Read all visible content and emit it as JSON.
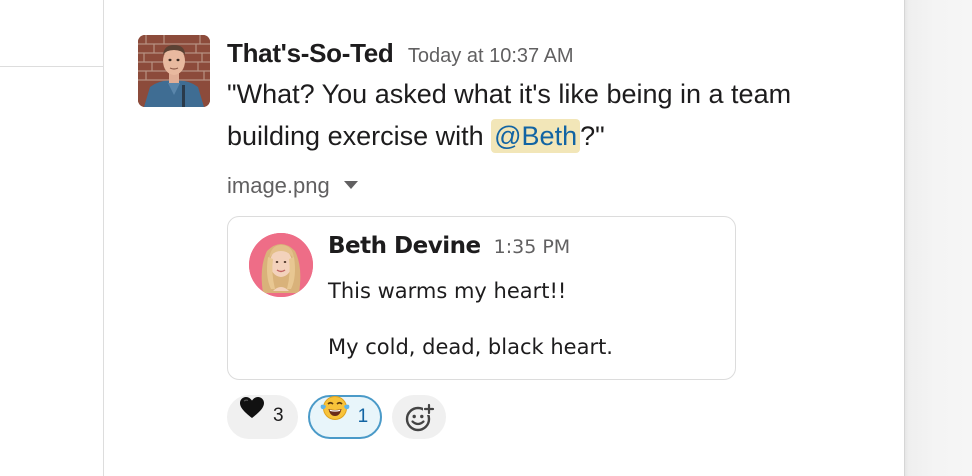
{
  "message": {
    "sender": "That's-So-Ted",
    "timestamp": "Today at 10:37 AM",
    "text_before_mention": "\"What? You asked what it's like being in a team building exercise with ",
    "mention": "@Beth",
    "text_after_mention": "?\"",
    "attachment": {
      "filename": "image.png",
      "caret_icon": "chevron-down-icon",
      "embedded": {
        "sender": "Beth Devine",
        "time": "1:35 PM",
        "line1": "This warms my heart!!",
        "line2": "My cold, dead, black heart."
      }
    },
    "reactions": [
      {
        "emoji": "black-heart",
        "count": "3",
        "active": false
      },
      {
        "emoji": "face-with-tears-of-joy",
        "count": "1",
        "active": true
      }
    ],
    "add_reaction_icon": "add-reaction-icon"
  },
  "colors": {
    "mention_bg": "#f2e6b8",
    "mention_fg": "#1264a3",
    "active_reaction_border": "#4a9ac8",
    "reaction_bg": "#f0f0f0"
  }
}
